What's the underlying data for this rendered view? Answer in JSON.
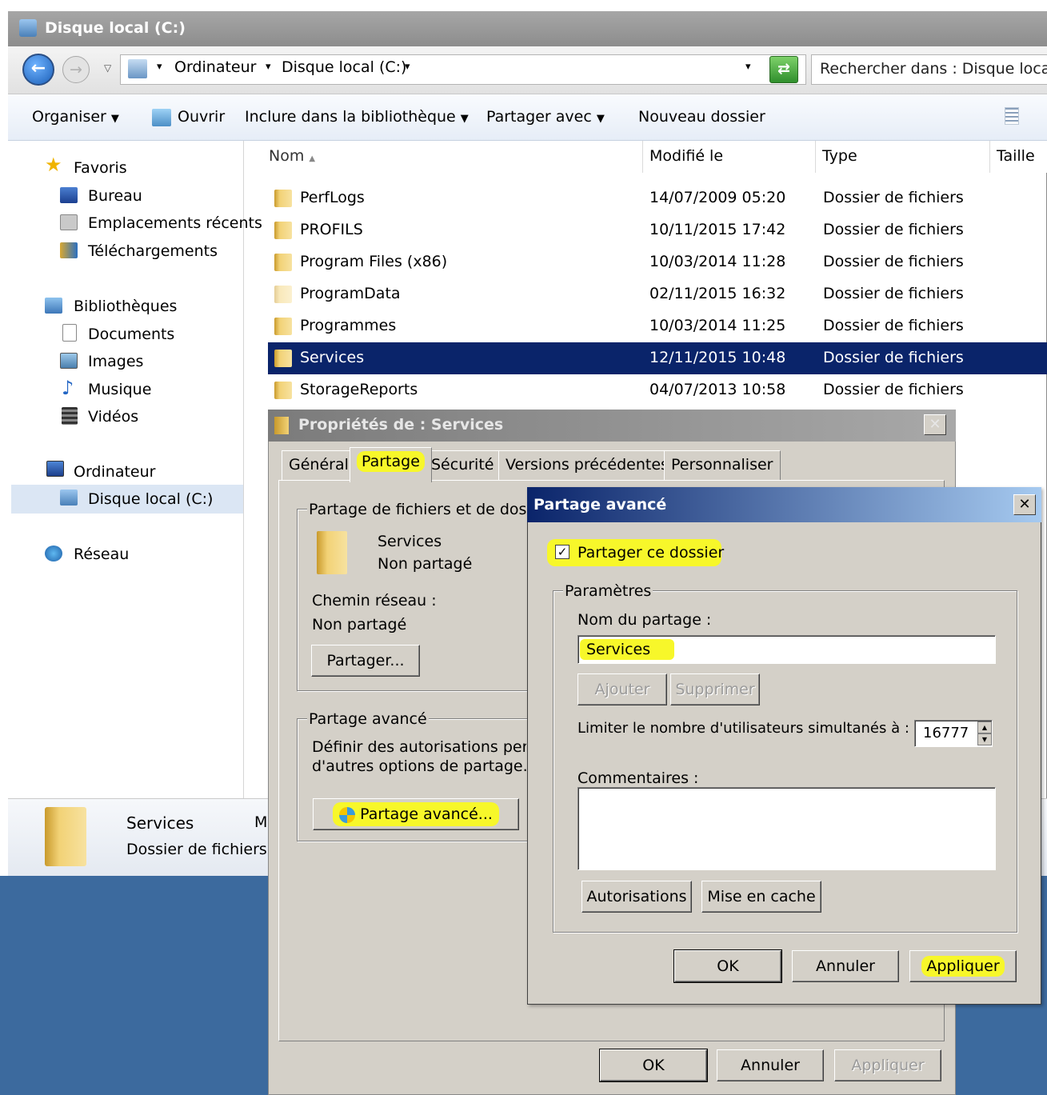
{
  "explorer": {
    "title": "Disque local (C:)",
    "breadcrumb": [
      "Ordinateur",
      "Disque local (C:)"
    ],
    "search_placeholder": "Rechercher dans : Disque local (C:)",
    "toolbar": {
      "organize": "Organiser",
      "open": "Ouvrir",
      "include_library": "Inclure dans la bibliothèque",
      "share_with": "Partager avec",
      "new_folder": "Nouveau dossier"
    },
    "nav": {
      "favorites": "Favoris",
      "desktop": "Bureau",
      "recent": "Emplacements récents",
      "downloads": "Téléchargements",
      "libraries": "Bibliothèques",
      "documents": "Documents",
      "images": "Images",
      "music": "Musique",
      "videos": "Vidéos",
      "computer": "Ordinateur",
      "local_disk": "Disque local (C:)",
      "network": "Réseau"
    },
    "columns": {
      "name": "Nom",
      "modified": "Modifié le",
      "type": "Type",
      "size": "Taille"
    },
    "files": [
      {
        "name": "PerfLogs",
        "modified": "14/07/2009 05:20",
        "type": "Dossier de fichiers"
      },
      {
        "name": "PROFILS",
        "modified": "10/11/2015 17:42",
        "type": "Dossier de fichiers"
      },
      {
        "name": "Program Files (x86)",
        "modified": "10/03/2014 11:28",
        "type": "Dossier de fichiers"
      },
      {
        "name": "ProgramData",
        "modified": "02/11/2015 16:32",
        "type": "Dossier de fichiers"
      },
      {
        "name": "Programmes",
        "modified": "10/03/2014 11:25",
        "type": "Dossier de fichiers"
      },
      {
        "name": "Services",
        "modified": "12/11/2015 10:48",
        "type": "Dossier de fichiers"
      },
      {
        "name": "StorageReports",
        "modified": "04/07/2013 10:58",
        "type": "Dossier de fichiers"
      }
    ],
    "details": {
      "name": "Services",
      "type": "Dossier de fichiers",
      "extra": "M"
    }
  },
  "properties": {
    "title": "Propriétés de : Services",
    "tabs": [
      "Général",
      "Partage",
      "Sécurité",
      "Versions précédentes",
      "Personnaliser"
    ],
    "file_sharing_group": "Partage de fichiers et de dossiers",
    "folder_name": "Services",
    "share_status": "Non partagé",
    "network_path_label": "Chemin réseau :",
    "network_path_value": "Non partagé",
    "share_button": "Partager...",
    "advanced_group": "Partage avancé",
    "advanced_desc_1": "Définir des autorisations person",
    "advanced_desc_2": "d'autres options de partage.",
    "advanced_button": "Partage avancé...",
    "ok": "OK",
    "cancel": "Annuler",
    "apply": "Appliquer"
  },
  "advanced": {
    "title": "Partage avancé",
    "share_checkbox_label": "Partager ce dossier",
    "share_checked": true,
    "params_group": "Paramètres",
    "share_name_label": "Nom du partage :",
    "share_name_value": "Services",
    "add": "Ajouter",
    "remove": "Supprimer",
    "limit_label": "Limiter le nombre d'utilisateurs simultanés à :",
    "limit_value": "16777",
    "comments_label": "Commentaires :",
    "permissions": "Autorisations",
    "caching": "Mise en cache",
    "ok": "OK",
    "cancel": "Annuler",
    "apply": "Appliquer"
  },
  "colors": {
    "selection": "#0a246a",
    "highlight": "#f7f72a",
    "dialog": "#d4d0c8"
  }
}
